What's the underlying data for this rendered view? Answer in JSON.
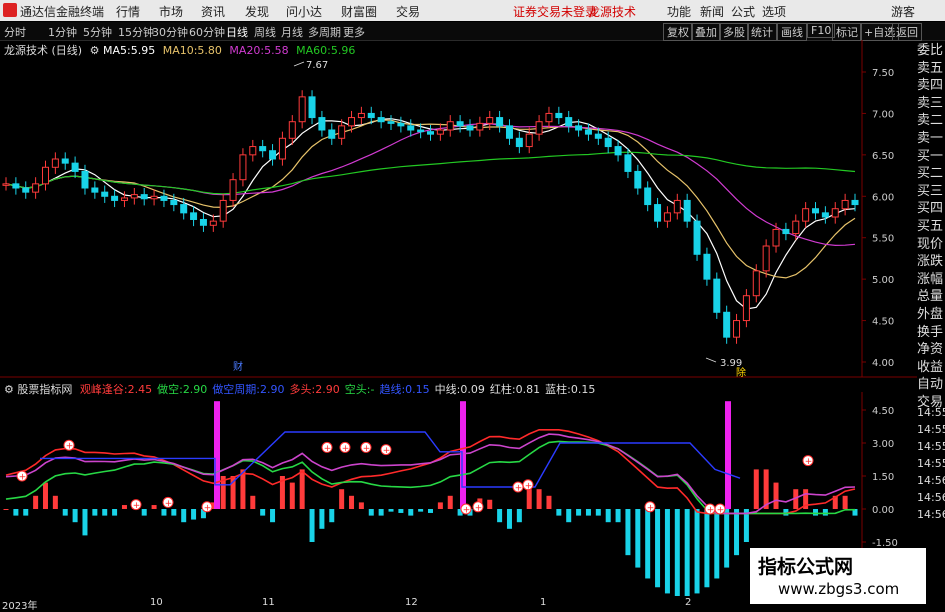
{
  "menu": {
    "app_name": "通达信金融终端",
    "items": [
      "行情",
      "市场",
      "资讯",
      "发现",
      "问小达",
      "财富圈",
      "交易"
    ],
    "alert": "证券交易未登录",
    "brand": "龙源技术",
    "right": [
      "功能",
      "新闻",
      "公式",
      "选项"
    ],
    "guest": "游客"
  },
  "toolbar": {
    "periods": [
      "分时",
      "1分钟",
      "5分钟",
      "15分钟",
      "30分钟",
      "60分钟",
      "日线",
      "周线",
      "月线",
      "多周期",
      "更多"
    ],
    "right": [
      "复权",
      "叠加",
      "多股",
      "统计",
      "画线",
      "F10",
      "标记",
      "+自选",
      "返回"
    ]
  },
  "main_chart": {
    "title": "龙源技术 (日线)",
    "ma": [
      {
        "label": "MA5:",
        "value": "5.95",
        "color": "#ffffff"
      },
      {
        "label": "MA10:",
        "value": "5.80",
        "color": "#e6c26a"
      },
      {
        "label": "MA20:",
        "value": "5.58",
        "color": "#d13bd1"
      },
      {
        "label": "MA60:",
        "value": "5.96",
        "color": "#23c823"
      }
    ],
    "high_mark": "7.67",
    "low_mark": "3.99",
    "event_label_1": "财",
    "event_label_2": "除",
    "y_ticks": [
      "7.50",
      "7.00",
      "6.50",
      "6.00",
      "5.50",
      "5.00",
      "4.50",
      "4.00"
    ]
  },
  "right_sidebar": [
    "委比",
    "卖五",
    "卖四",
    "卖三",
    "卖二",
    "卖一",
    "买一",
    "买二",
    "买三",
    "买四",
    "买五",
    "现价",
    "涨跌",
    "涨幅",
    "总量",
    "外盘",
    "换手",
    "净资",
    "收益",
    "自动",
    "交易"
  ],
  "indicator": {
    "name": "股票指标网",
    "fields": [
      {
        "label": "观峰逢谷:",
        "value": "2.45",
        "color": "#ff3b3b"
      },
      {
        "label": "做空:",
        "value": "2.90",
        "color": "#27d845"
      },
      {
        "label": "做空周期:",
        "value": "2.90",
        "color": "#3355ff"
      },
      {
        "label": "多头:",
        "value": "2.90",
        "color": "#ff3b3b"
      },
      {
        "label": "空头:",
        "value": "-",
        "color": "#27d845"
      },
      {
        "label": "趋线:",
        "value": "0.15",
        "color": "#3355ff"
      },
      {
        "label": "中线:",
        "value": "0.09",
        "color": "#dddddd"
      },
      {
        "label": "红柱:",
        "value": "0.81",
        "color": "#dddddd"
      },
      {
        "label": "蓝柱:",
        "value": "0.15",
        "color": "#dddddd"
      }
    ],
    "y_ticks": [
      "4.50",
      "3.00",
      "1.50",
      "0.00",
      "-1.50"
    ],
    "right_times": [
      "14:55",
      "14:55",
      "14:55",
      "14:55",
      "14:56",
      "14:56",
      "14:56"
    ]
  },
  "date_axis": [
    "2023年",
    "10",
    "11",
    "12",
    "1",
    "2"
  ],
  "watermark": {
    "title": "指标公式网",
    "url": "www.zbgs3.com"
  },
  "colors": {
    "up": "#ff3b3b",
    "down": "#19d3e8",
    "ma5": "#ffffff",
    "ma10": "#e6c26a",
    "ma20": "#d13bd1",
    "ma60": "#23c823"
  }
}
